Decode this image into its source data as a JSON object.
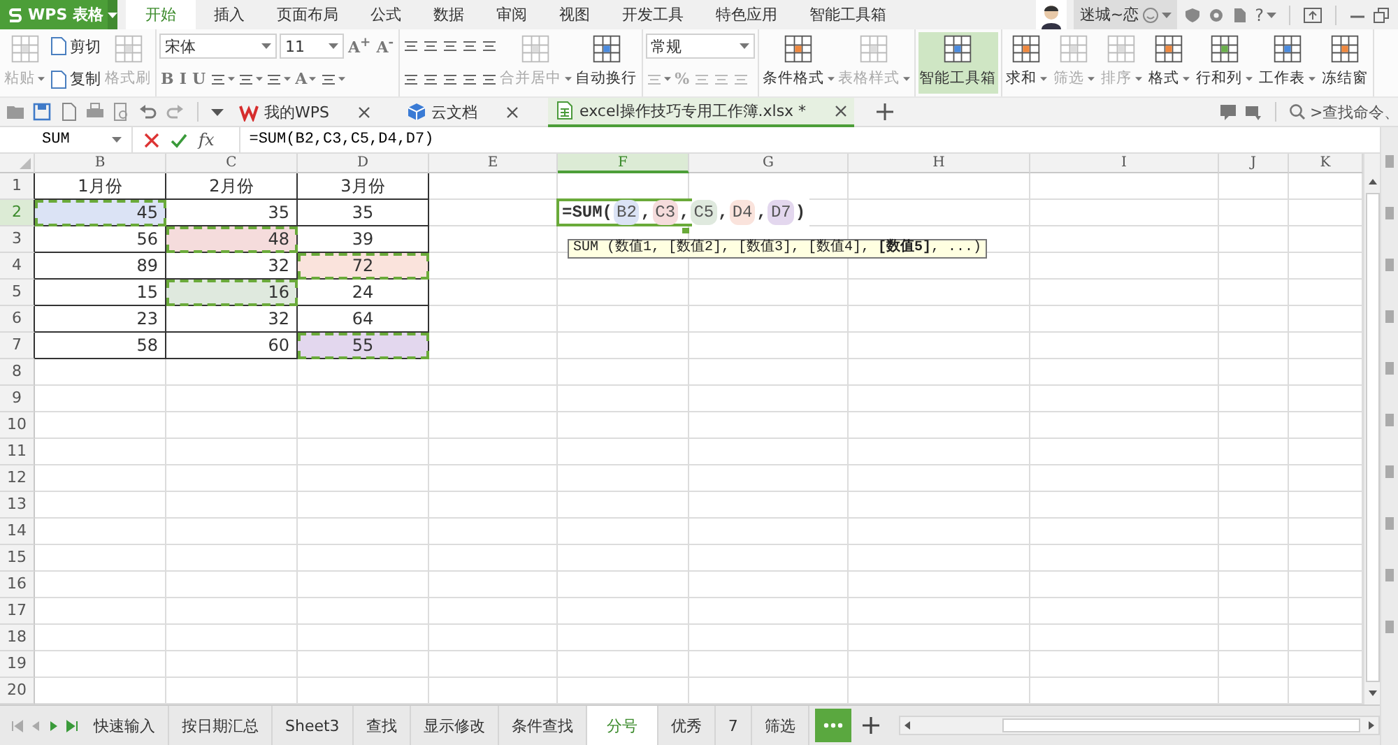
{
  "app": {
    "name": "WPS 表格"
  },
  "menu_tabs": [
    {
      "label": "开始",
      "selected": true
    },
    {
      "label": "插入",
      "selected": false
    },
    {
      "label": "页面布局",
      "selected": false
    },
    {
      "label": "公式",
      "selected": false
    },
    {
      "label": "数据",
      "selected": false
    },
    {
      "label": "审阅",
      "selected": false
    },
    {
      "label": "视图",
      "selected": false
    },
    {
      "label": "开发工具",
      "selected": false
    },
    {
      "label": "特色应用",
      "selected": false
    },
    {
      "label": "智能工具箱",
      "selected": false
    }
  ],
  "user": {
    "name": "迷城~恋"
  },
  "help": {
    "label": "?"
  },
  "ribbon": [
    {
      "items": [
        {
          "kind": "large",
          "label": "粘贴",
          "caret": true,
          "disabled": true,
          "active": false
        },
        {
          "kind": "stack",
          "upper": [
            {
              "kind": "small",
              "label": "剪切",
              "caret": false,
              "disabled": false
            }
          ],
          "lower": [
            {
              "kind": "small",
              "label": "复制",
              "caret": false,
              "disabled": false
            }
          ]
        },
        {
          "kind": "large",
          "label": "格式刷",
          "caret": false,
          "disabled": true,
          "active": false
        }
      ]
    },
    {
      "items": [
        {
          "kind": "stack",
          "upper": [
            {
              "kind": "select",
              "value": "宋体"
            },
            {
              "kind": "select",
              "value": "11"
            },
            {
              "kind": "glyph",
              "label": "A$^{+}$",
              "caret": false,
              "disabled": false
            },
            {
              "kind": "glyph",
              "label": "A$^{-}$",
              "caret": false,
              "disabled": false
            }
          ],
          "lower": [
            {
              "kind": "glyph",
              "label": "B",
              "caret": false,
              "disabled": false
            },
            {
              "kind": "glyph",
              "label": "I",
              "caret": false,
              "disabled": false
            },
            {
              "kind": "glyph",
              "label": "U",
              "caret": false,
              "disabled": false
            },
            {
              "kind": "icon",
              "caret": true,
              "disabled": false
            },
            {
              "kind": "icon",
              "caret": true,
              "disabled": false
            },
            {
              "kind": "icon",
              "caret": true,
              "disabled": false
            },
            {
              "kind": "glyph",
              "label": "A",
              "caret": true,
              "disabled": false
            },
            {
              "kind": "icon",
              "caret": true,
              "disabled": false
            }
          ]
        }
      ]
    },
    {
      "items": [
        {
          "kind": "stack",
          "upper": [
            {
              "kind": "icon",
              "caret": false,
              "disabled": false
            },
            {
              "kind": "icon",
              "caret": false,
              "disabled": false
            },
            {
              "kind": "icon",
              "caret": false,
              "disabled": false
            },
            {
              "kind": "icon",
              "caret": false,
              "disabled": false
            },
            {
              "kind": "icon",
              "caret": false,
              "disabled": false
            }
          ],
          "lower": [
            {
              "kind": "icon",
              "caret": false,
              "disabled": false
            },
            {
              "kind": "icon",
              "caret": false,
              "disabled": false
            },
            {
              "kind": "icon",
              "caret": false,
              "disabled": false
            },
            {
              "kind": "icon",
              "caret": false,
              "disabled": false
            },
            {
              "kind": "icon",
              "caret": false,
              "disabled": false
            }
          ]
        },
        {
          "kind": "large",
          "label": "合并居中",
          "caret": true,
          "disabled": true,
          "active": false
        },
        {
          "kind": "large",
          "label": "自动换行",
          "caret": false,
          "disabled": false,
          "active": false
        }
      ]
    },
    {
      "items": [
        {
          "kind": "stack",
          "upper": [
            {
              "kind": "select",
              "value": "常规"
            }
          ],
          "lower": [
            {
              "kind": "icon",
              "caret": true,
              "disabled": true
            },
            {
              "kind": "glyph",
              "label": "%",
              "caret": false,
              "disabled": true
            },
            {
              "kind": "icon",
              "caret": false,
              "disabled": true
            },
            {
              "kind": "icon",
              "caret": false,
              "disabled": true
            },
            {
              "kind": "icon",
              "caret": false,
              "disabled": true
            }
          ]
        }
      ]
    },
    {
      "items": [
        {
          "kind": "large",
          "label": "条件格式",
          "caret": true,
          "disabled": false,
          "active": false
        },
        {
          "kind": "large",
          "label": "表格样式",
          "caret": true,
          "disabled": true,
          "active": false
        }
      ]
    },
    {
      "items": [
        {
          "kind": "large",
          "label": "智能工具箱",
          "caret": false,
          "disabled": false,
          "active": true
        }
      ]
    },
    {
      "items": [
        {
          "kind": "large",
          "label": "求和",
          "caret": true,
          "disabled": false,
          "active": false
        },
        {
          "kind": "large",
          "label": "筛选",
          "caret": true,
          "disabled": true,
          "active": false
        },
        {
          "kind": "large",
          "label": "排序",
          "caret": true,
          "disabled": true,
          "active": false
        },
        {
          "kind": "large",
          "label": "格式",
          "caret": true,
          "disabled": false,
          "active": false
        },
        {
          "kind": "large",
          "label": "行和列",
          "caret": true,
          "disabled": false,
          "active": false
        },
        {
          "kind": "large",
          "label": "工作表",
          "caret": true,
          "disabled": false,
          "active": false
        },
        {
          "kind": "large",
          "label": "冻结窗",
          "caret": false,
          "disabled": false,
          "active": false
        }
      ]
    }
  ],
  "doc_tabs": [
    {
      "label": "我的WPS",
      "selected": false
    },
    {
      "label": "云文档",
      "selected": false
    },
    {
      "label": "excel操作技巧专用工作簿.xlsx *",
      "selected": true
    }
  ],
  "search": {
    "placeholder": ">查找命令、"
  },
  "formula_bar": {
    "name_box": "SUM",
    "fx": "fx",
    "formula": "=SUM(B2,C3,C5,D4,D7)"
  },
  "sheet": {
    "columns": [
      {
        "label": "B",
        "selected": false
      },
      {
        "label": "C",
        "selected": false
      },
      {
        "label": "D",
        "selected": false
      },
      {
        "label": "E",
        "selected": false
      },
      {
        "label": "F",
        "selected": true
      },
      {
        "label": "G",
        "selected": false
      },
      {
        "label": "H",
        "selected": false
      },
      {
        "label": "I",
        "selected": false
      },
      {
        "label": "J",
        "selected": false
      },
      {
        "label": "K",
        "selected": false
      }
    ],
    "rows": [
      {
        "number": "1",
        "selected": false,
        "cells": [
          {
            "kind": "value",
            "text": "1月份"
          },
          {
            "kind": "value",
            "text": "2月份"
          },
          {
            "kind": "value",
            "text": "3月份"
          }
        ]
      },
      {
        "number": "2",
        "selected": true,
        "cells": [
          {
            "kind": "value",
            "text": "45",
            "color": "#dbe3f5"
          },
          {
            "kind": "value",
            "text": "35"
          },
          {
            "kind": "value",
            "text": "35"
          },
          {
            "kind": "blank"
          },
          {
            "kind": "editor",
            "parts": [
              {
                "text": "=SUM("
              },
              {
                "text": "B2",
                "color": "#dbe3f5"
              },
              {
                "text": ","
              },
              {
                "text": "C3",
                "color": "#f5dcdc"
              },
              {
                "text": ","
              },
              {
                "text": "C5",
                "color": "#dfe9de"
              },
              {
                "text": ","
              },
              {
                "text": "D4",
                "color": "#fae3dc"
              },
              {
                "text": ","
              },
              {
                "text": "D7",
                "color": "#e3d7ee"
              },
              {
                "text": ")"
              }
            ],
            "hint": "SUM (数值1, [数值2], [数值3], [数值4], **[数值5]**, ...)"
          }
        ]
      },
      {
        "number": "3",
        "selected": false,
        "cells": [
          {
            "kind": "value",
            "text": "56"
          },
          {
            "kind": "value",
            "text": "48",
            "color": "#f5dcdc"
          },
          {
            "kind": "value",
            "text": "39"
          }
        ]
      },
      {
        "number": "4",
        "selected": false,
        "cells": [
          {
            "kind": "value",
            "text": "89"
          },
          {
            "kind": "value",
            "text": "32"
          },
          {
            "kind": "value",
            "text": "72",
            "color": "#fae3dc"
          }
        ]
      },
      {
        "number": "5",
        "selected": false,
        "cells": [
          {
            "kind": "value",
            "text": "15"
          },
          {
            "kind": "value",
            "text": "16",
            "color": "#dfe9de"
          },
          {
            "kind": "value",
            "text": "24"
          }
        ]
      },
      {
        "number": "6",
        "selected": false,
        "cells": [
          {
            "kind": "value",
            "text": "23"
          },
          {
            "kind": "value",
            "text": "32"
          },
          {
            "kind": "value",
            "text": "64"
          }
        ]
      },
      {
        "number": "7",
        "selected": false,
        "cells": [
          {
            "kind": "value",
            "text": "58"
          },
          {
            "kind": "value",
            "text": "60"
          },
          {
            "kind": "value",
            "text": "55",
            "color": "#e3d7ee"
          }
        ]
      },
      {
        "number": "8",
        "selected": false
      },
      {
        "number": "9",
        "selected": false
      },
      {
        "number": "10",
        "selected": false
      },
      {
        "number": "11",
        "selected": false
      },
      {
        "number": "12",
        "selected": false
      },
      {
        "number": "13",
        "selected": false
      },
      {
        "number": "14",
        "selected": false
      },
      {
        "number": "15",
        "selected": false
      },
      {
        "number": "16",
        "selected": false
      },
      {
        "number": "17",
        "selected": false
      },
      {
        "number": "18",
        "selected": false
      },
      {
        "number": "19",
        "selected": false
      },
      {
        "number": "20",
        "selected": false
      }
    ]
  },
  "sheet_tabs": [
    {
      "label": "快速输入",
      "selected": false
    },
    {
      "label": "按日期汇总",
      "selected": false
    },
    {
      "label": "Sheet3",
      "selected": false
    },
    {
      "label": "查找",
      "selected": false
    },
    {
      "label": "显示修改",
      "selected": false
    },
    {
      "label": "条件查找",
      "selected": false
    },
    {
      "label": "分号",
      "selected": true
    },
    {
      "label": "优秀",
      "selected": false
    },
    {
      "label": "7",
      "selected": false
    },
    {
      "label": "筛选",
      "selected": false
    }
  ]
}
